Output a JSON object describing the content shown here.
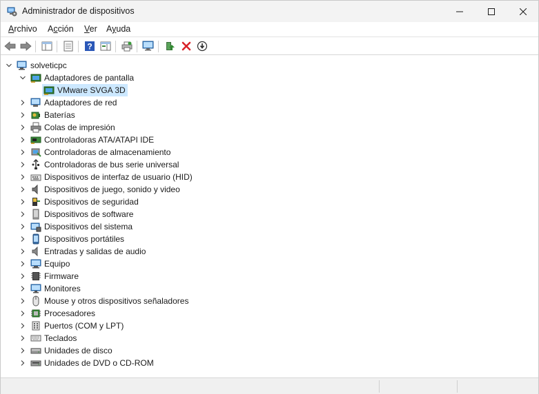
{
  "window": {
    "title": "Administrador de dispositivos",
    "icon": "device-manager-icon"
  },
  "menu": [
    {
      "label": "Archivo",
      "accel": "A",
      "rest": "rchivo"
    },
    {
      "label": "Acción",
      "accel": "c",
      "pre": "A",
      "rest": "ción"
    },
    {
      "label": "Ver",
      "accel": "V",
      "rest": "er"
    },
    {
      "label": "Ayuda",
      "accel": "y",
      "pre": "A",
      "rest": "uda"
    }
  ],
  "toolbar": [
    "back-arrow-icon",
    "forward-arrow-icon",
    "show-hide-console-tree-icon",
    "properties-icon",
    "help-icon",
    "action-pane-icon",
    "scan-hardware-icon",
    "update-driver-icon",
    "enable-device-icon",
    "uninstall-device-icon",
    "disable-device-icon"
  ],
  "tree": {
    "root": "solveticpc",
    "expanded_category": "Adaptadores de pantalla",
    "selected_device": "VMware SVGA 3D",
    "categories": [
      "Adaptadores de pantalla",
      "Adaptadores de red",
      "Baterías",
      "Colas de impresión",
      "Controladoras ATA/ATAPI IDE",
      "Controladoras de almacenamiento",
      "Controladoras de bus serie universal",
      "Dispositivos de interfaz de usuario (HID)",
      "Dispositivos de juego, sonido y video",
      "Dispositivos de seguridad",
      "Dispositivos de software",
      "Dispositivos del sistema",
      "Dispositivos portátiles",
      "Entradas y salidas de audio",
      "Equipo",
      "Firmware",
      "Monitores",
      "Mouse y otros dispositivos señaladores",
      "Procesadores",
      "Puertos (COM y LPT)",
      "Teclados",
      "Unidades de disco",
      "Unidades de DVD o CD-ROM"
    ]
  }
}
